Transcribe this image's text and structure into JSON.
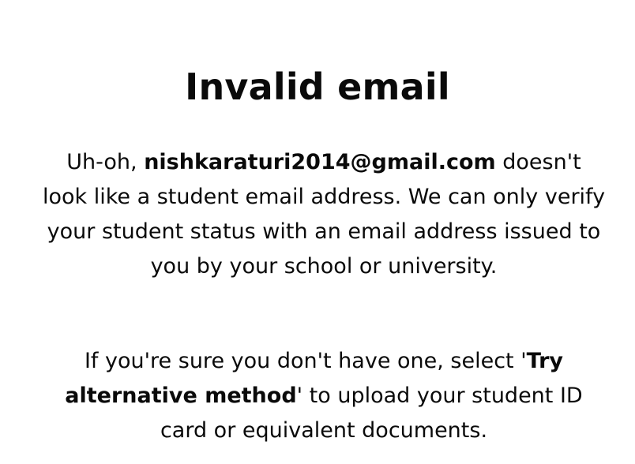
{
  "dialog": {
    "title": "Invalid email",
    "paragraph1": {
      "prefix": "Uh-oh, ",
      "email": "nishkaraturi2014@gmail.com",
      "suffix": " doesn't look like a student email address. We can only verify your student status with an email address issued to you by your school or university."
    },
    "paragraph2": {
      "prefix": "If you're sure you don't have one, select '",
      "action_name": "Try alternative method",
      "suffix": "' to upload your student ID card or equivalent documents."
    }
  }
}
